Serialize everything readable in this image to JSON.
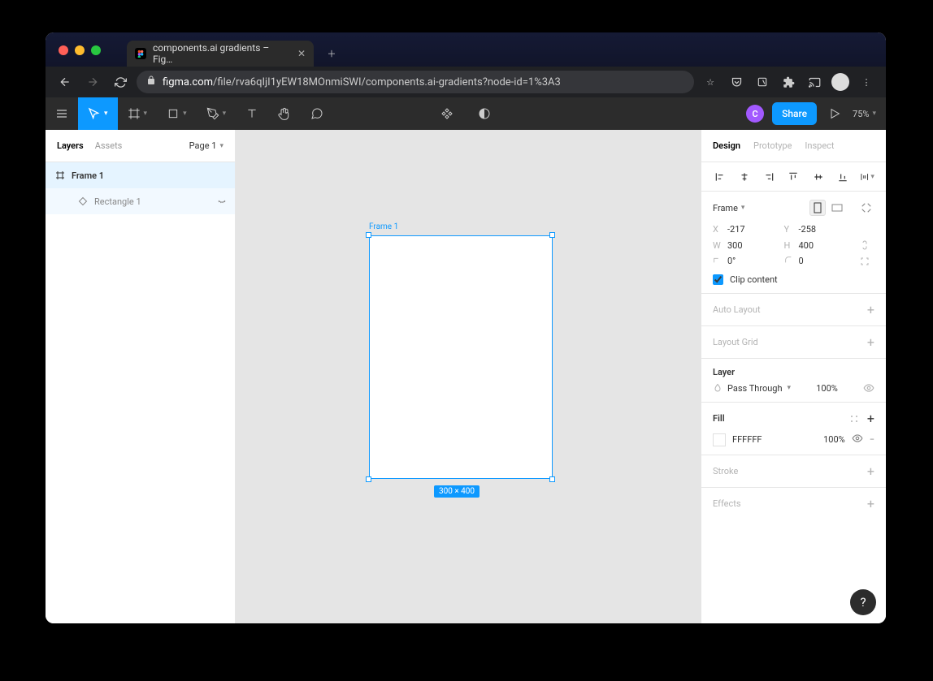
{
  "browser": {
    "tab_title": "components.ai gradients – Fig…",
    "url_domain": "figma.com",
    "url_path": "/file/rva6qIjI1yEW18MOnmiSWI/components.ai-gradients?node-id=1%3A3"
  },
  "toolbar": {
    "user_initial": "C",
    "share": "Share",
    "zoom": "75%"
  },
  "left_panel": {
    "tabs": {
      "layers": "Layers",
      "assets": "Assets"
    },
    "page": "Page 1",
    "layers": [
      {
        "name": "Frame 1",
        "type": "frame",
        "selected": true
      },
      {
        "name": "Rectangle 1",
        "type": "rectangle",
        "selected": false,
        "hidden": true
      }
    ]
  },
  "canvas": {
    "frame_label": "Frame 1",
    "dimensions": "300 × 400"
  },
  "right_panel": {
    "tabs": {
      "design": "Design",
      "prototype": "Prototype",
      "inspect": "Inspect"
    },
    "frame_label": "Frame",
    "x": {
      "label": "X",
      "value": "-217"
    },
    "y": {
      "label": "Y",
      "value": "-258"
    },
    "w": {
      "label": "W",
      "value": "300"
    },
    "h": {
      "label": "H",
      "value": "400"
    },
    "rotation": {
      "value": "0°"
    },
    "radius": {
      "value": "0"
    },
    "clip_content": "Clip content",
    "auto_layout": "Auto Layout",
    "layout_grid": "Layout Grid",
    "layer_section": "Layer",
    "blend_mode": "Pass Through",
    "layer_opacity": "100%",
    "fill_section": "Fill",
    "fill_hex": "FFFFFF",
    "fill_opacity": "100%",
    "stroke_section": "Stroke",
    "effects_section": "Effects"
  }
}
